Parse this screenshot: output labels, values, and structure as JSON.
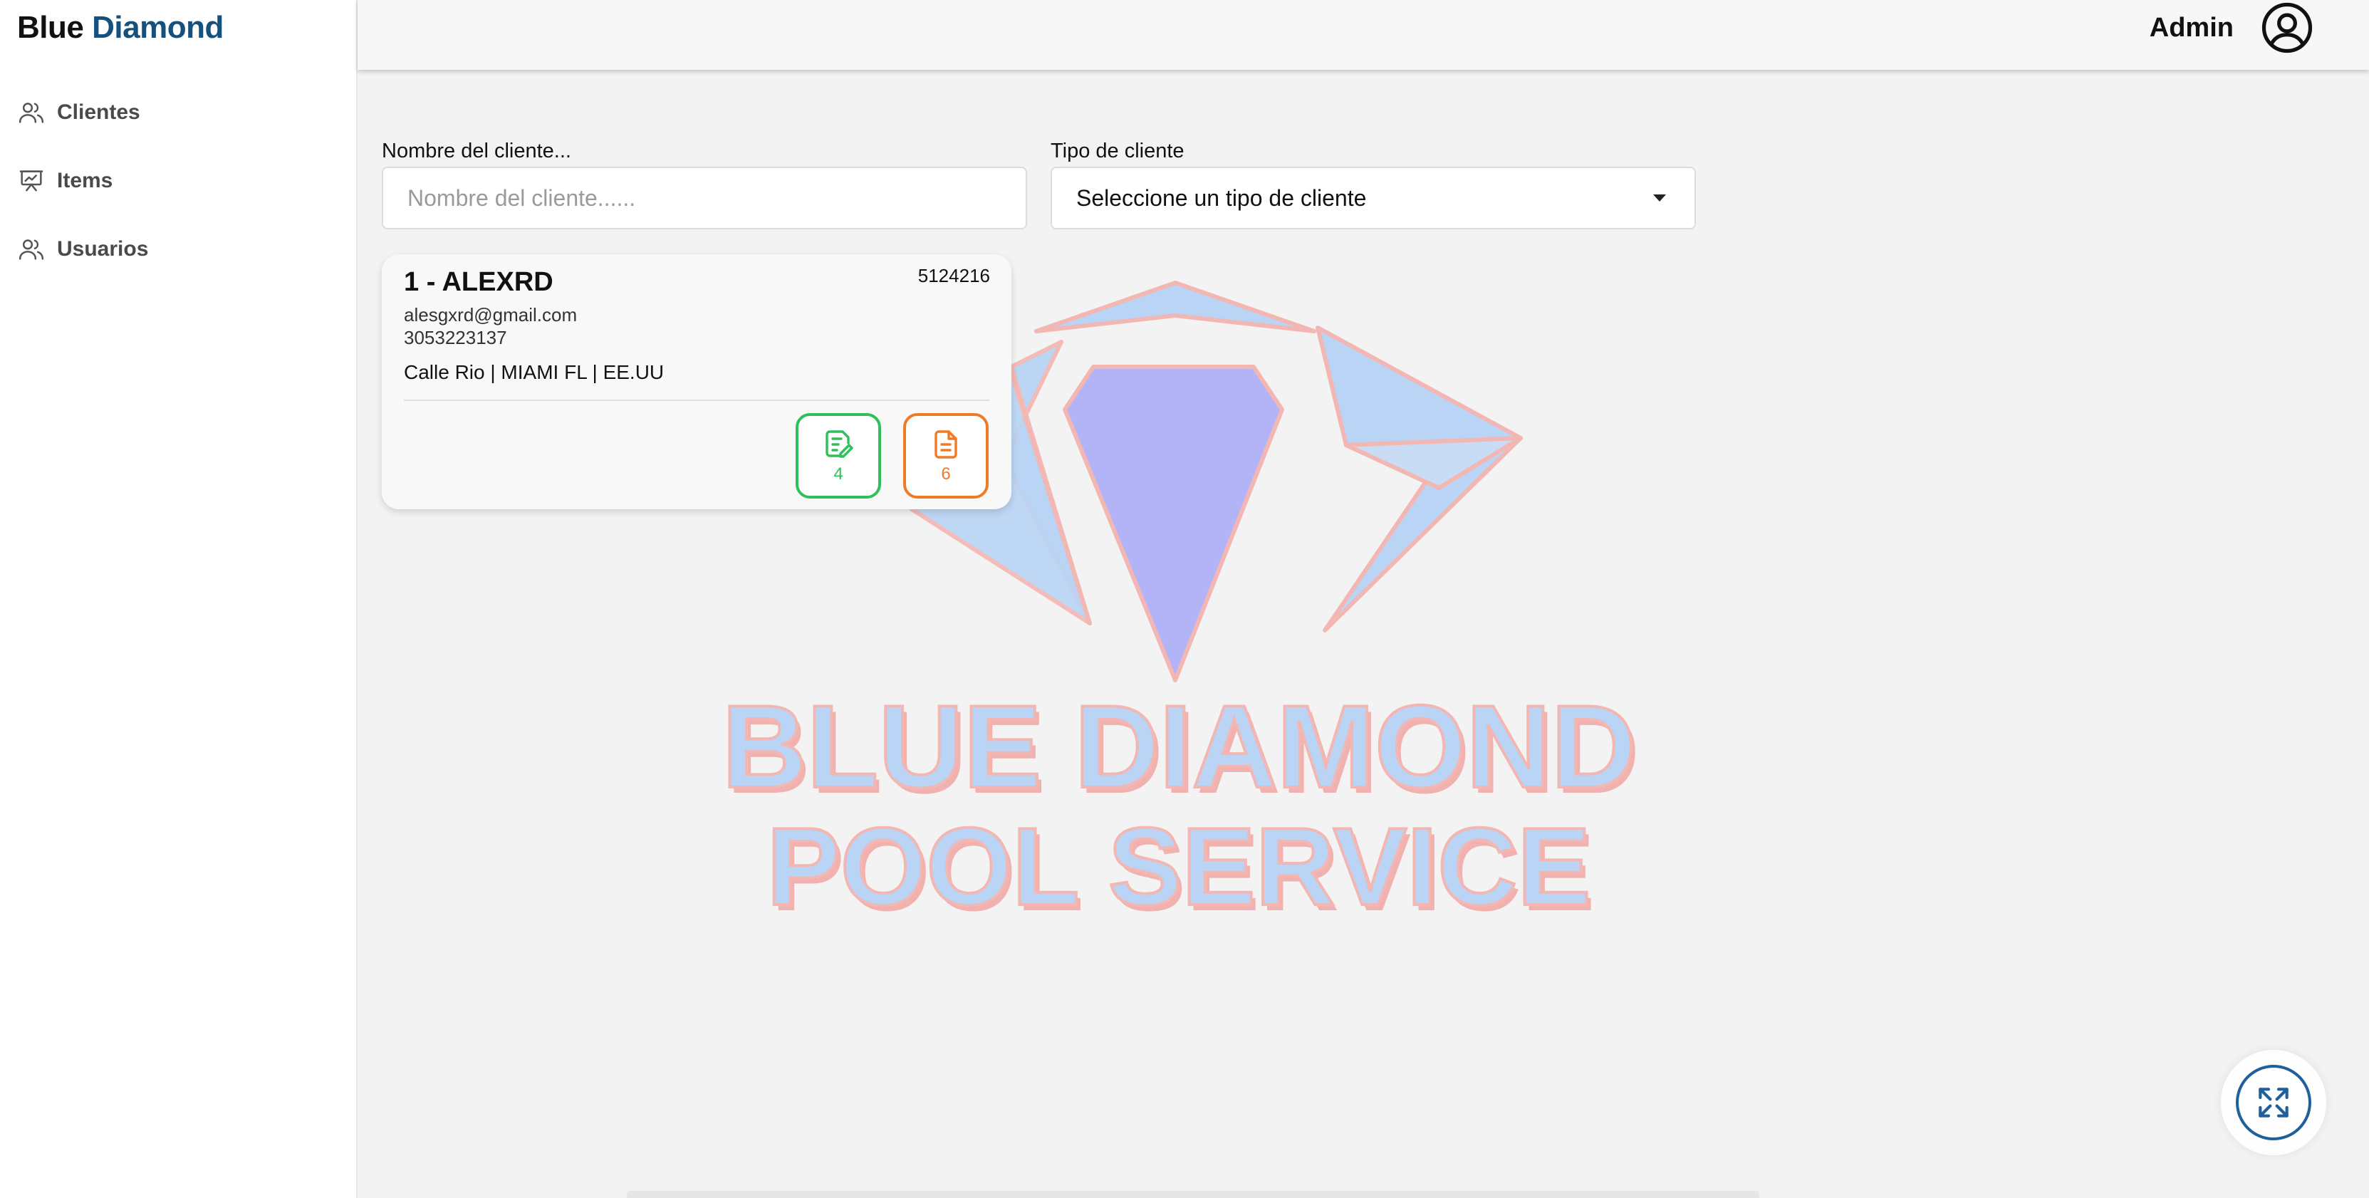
{
  "brand": {
    "part1": "Blue",
    "part2": "Diamond"
  },
  "sidebar": {
    "items": [
      {
        "label": "Clientes",
        "icon": "users-icon"
      },
      {
        "label": "Items",
        "icon": "presentation-chart-icon"
      },
      {
        "label": "Usuarios",
        "icon": "users-icon"
      }
    ]
  },
  "header": {
    "user_label": "Admin",
    "avatar_icon": "user-circle-icon"
  },
  "filters": {
    "name_label": "Nombre del cliente...",
    "name_placeholder": "Nombre del cliente......",
    "type_label": "Tipo de cliente",
    "type_selected": "Seleccione un tipo de cliente"
  },
  "watermark": {
    "line1": "BLUE DIAMOND",
    "line2": "POOL SERVICE"
  },
  "clients": [
    {
      "title": "1 - ALEXRD",
      "code": "5124216",
      "email": "alesgxrd@gmail.com",
      "phone": "3053223137",
      "address": "Calle Rio | MIAMI FL | EE.UU",
      "actions": [
        {
          "icon": "edit-document-icon",
          "count": "4",
          "color": "#2fbf5b"
        },
        {
          "icon": "document-icon",
          "count": "6",
          "color": "#ef7a27"
        }
      ]
    }
  ],
  "fullscreen": {
    "icon": "expand-arrows-icon"
  },
  "colors": {
    "brand_blue": "#16507c",
    "green": "#2fbf5b",
    "orange": "#ef7a27",
    "accent": "#1f5f9a"
  }
}
